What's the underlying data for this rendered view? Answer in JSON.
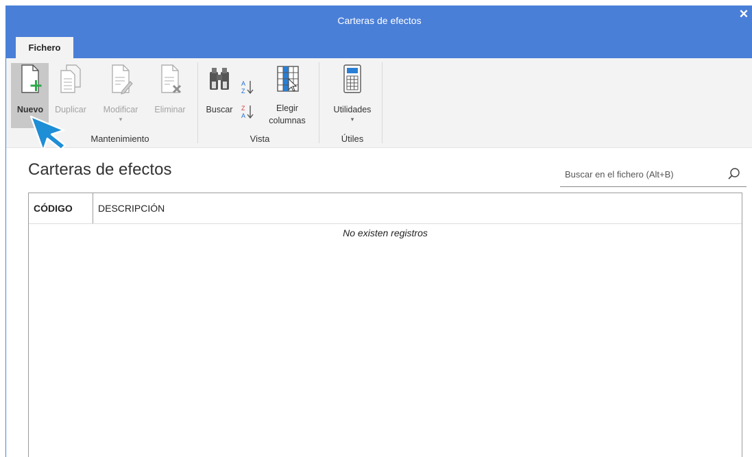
{
  "window": {
    "title": "Carteras de efectos",
    "close_glyph": "✕"
  },
  "tabs": [
    {
      "label": "Fichero"
    }
  ],
  "ribbon": {
    "buttons": [
      {
        "label": "Nuevo",
        "icon": "new-document-icon",
        "enabled": true
      },
      {
        "label": "Duplicar",
        "icon": "duplicate-icon",
        "enabled": false
      },
      {
        "label": "Modificar",
        "icon": "edit-document-icon",
        "enabled": false
      },
      {
        "label": "Eliminar",
        "icon": "delete-document-icon",
        "enabled": false
      },
      {
        "label": "Buscar",
        "icon": "binoculars-icon",
        "enabled": true
      },
      {
        "label": "Elegir columnas",
        "icon": "choose-columns-icon",
        "enabled": true
      },
      {
        "label": "Utilidades",
        "icon": "calculator-icon",
        "enabled": true
      }
    ],
    "groups": [
      {
        "label": "Mantenimiento"
      },
      {
        "label": "Vista"
      },
      {
        "label": "Útiles"
      }
    ],
    "dropdown_glyph": "▾"
  },
  "content": {
    "title": "Carteras de efectos",
    "search_placeholder": "Buscar en el fichero (Alt+B)"
  },
  "grid": {
    "columns": [
      "CÓDIGO",
      "DESCRIPCIÓN"
    ],
    "empty_text": "No existen registros",
    "rows": []
  },
  "colors": {
    "accent": "#4a7fd8",
    "ribbon_bg": "#f3f3f3",
    "pointer": "#1e8ed6"
  }
}
